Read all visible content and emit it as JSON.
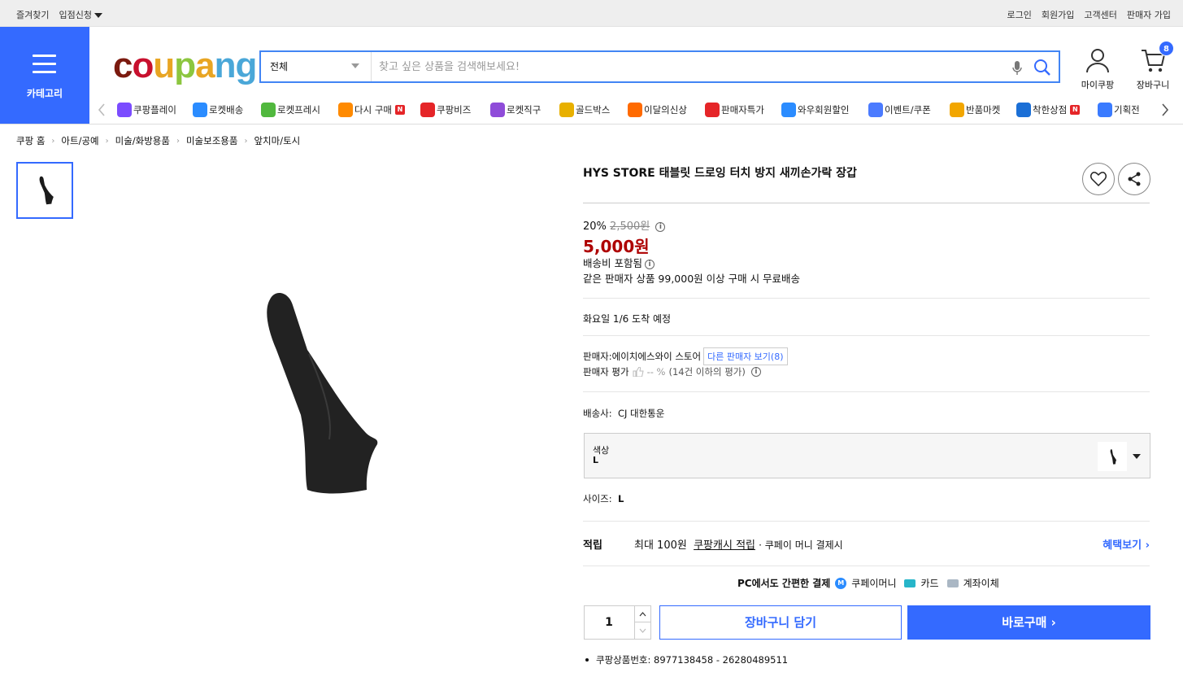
{
  "topbar": {
    "left": [
      "즐겨찾기",
      "입점신청"
    ],
    "right": [
      "로그인",
      "회원가입",
      "고객센터",
      "판매자 가입"
    ]
  },
  "category_label": "카테고리",
  "logo": {
    "letters": [
      "c",
      "o",
      "u",
      "p",
      "a",
      "n",
      "g"
    ],
    "colors": [
      "#7b1a0f",
      "#c8102e",
      "#e8a523",
      "#8cc63f",
      "#e8a523",
      "#4aa7d8",
      "#4aa7d8"
    ]
  },
  "search": {
    "scope": "전체",
    "placeholder": "찾고 싶은 상품을 검색해보세요!"
  },
  "header_links": {
    "my": "마이쿠팡",
    "cart": "장바구니",
    "cart_count": "8"
  },
  "nav": [
    {
      "label": "쿠팡플레이",
      "icon": "play-icon",
      "color": "#7b4cff"
    },
    {
      "label": "로켓배송",
      "icon": "rocket-icon",
      "color": "#2b8cff"
    },
    {
      "label": "로켓프레시",
      "icon": "rocket-fresh-icon",
      "color": "#51b83e"
    },
    {
      "label": "다시 구매",
      "icon": "basket-icon",
      "color": "#ff8a00",
      "badge": "N"
    },
    {
      "label": "쿠팡비즈",
      "icon": "biz-icon",
      "color": "#e52528"
    },
    {
      "label": "로켓직구",
      "icon": "globe-rocket-icon",
      "color": "#8f4cd9"
    },
    {
      "label": "골드박스",
      "icon": "gold-box-icon",
      "color": "#e8b000"
    },
    {
      "label": "이달의신상",
      "icon": "new-bag-icon",
      "color": "#ff6a00"
    },
    {
      "label": "판매자특가",
      "icon": "percent-badge-icon",
      "color": "#e52528"
    },
    {
      "label": "와우회원할인",
      "icon": "wow-icon",
      "color": "#2b8cff"
    },
    {
      "label": "이벤트/쿠폰",
      "icon": "coupon-icon",
      "color": "#4b7bff"
    },
    {
      "label": "반품마켓",
      "icon": "market-icon",
      "color": "#f2a600"
    },
    {
      "label": "착한상점",
      "icon": "store-icon",
      "color": "#1b6fd6",
      "badge": "N"
    },
    {
      "label": "기획전",
      "icon": "tag-icon",
      "color": "#3a7bff"
    }
  ],
  "breadcrumb": [
    "쿠팡 홈",
    "아트/공예",
    "미술/화방용품",
    "미술보조용품",
    "앞치마/토시"
  ],
  "product": {
    "title": "HYS STORE 태블릿 드로잉 터치 방지 새끼손가락 장갑",
    "discount": "20%",
    "original_price": "2,500원",
    "price": "5,000원",
    "shipping": "배송비 포함됨",
    "free_shipping": "같은 판매자 상품 99,000원 이상 구매 시 무료배송",
    "arrival": "화요일 1/6 도착 예정",
    "seller_label": "판매자:",
    "seller_name": "에이치에스와이 스토어",
    "other_sellers": "다른 판매자 보기(8)",
    "rating_label": "판매자 평가",
    "rating_value": "-- %",
    "rating_note": "(14건 이하의 평가)",
    "carrier_label": "배송사:",
    "carrier": "CJ 대한통운",
    "option_key": "색상",
    "option_value": "L",
    "size_label": "사이즈:",
    "size_value": "L",
    "reward_label": "적립",
    "reward_max": "최대 100원",
    "reward_cash": "쿠팡캐시 적립",
    "reward_cond": "· 쿠페이 머니 결제시",
    "reward_more": "혜택보기",
    "pay_title": "PC에서도 간편한 결제",
    "pay_methods": [
      "쿠페이머니",
      "카드",
      "계좌이체"
    ],
    "quantity": "1",
    "add_cart": "장바구니 담기",
    "buy_now": "바로구매",
    "product_no_label": "쿠팡상품번호:",
    "product_no": "8977138458 - 26280489511"
  }
}
